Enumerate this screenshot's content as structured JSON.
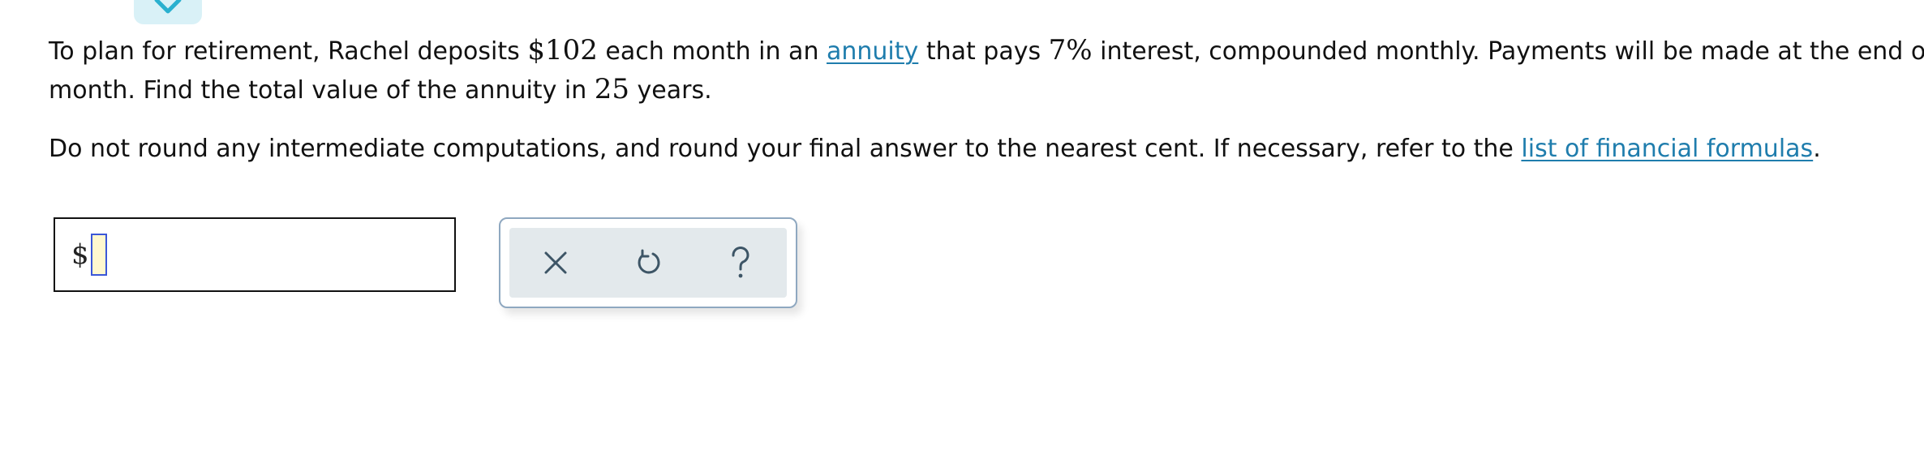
{
  "question": {
    "p1": {
      "t1": "To plan for retirement, Rachel deposits ",
      "m1": "$102",
      "t2": " each month in an ",
      "link_annuity": "annuity",
      "t3": " that pays ",
      "m2": "7%",
      "t4": " interest, compounded monthly. Payments will be made at the end of each"
    },
    "p2": {
      "t1": "month. Find the total value of the annuity in ",
      "m1": "25",
      "t2": " years."
    },
    "p3": {
      "t1": "Do not round any intermediate computations, and round your final answer to the nearest cent. If necessary, refer to the ",
      "link_formulas": "list of financial formulas",
      "t2": "."
    }
  },
  "answer": {
    "prefix": "$",
    "value": ""
  },
  "icons": {
    "collapse": "chevron-down-icon",
    "clear": "close-icon",
    "undo": "undo-icon",
    "help": "help-icon"
  },
  "colors": {
    "link": "#1f7dad",
    "accent": "#2ab0cf",
    "tab_bg": "#d9f1f7",
    "tool_bg": "#e3e9ec",
    "tool_border": "#8fa8c0",
    "icon": "#3d5566",
    "field_bg": "#fff8cf",
    "field_border": "#3b57d8"
  }
}
